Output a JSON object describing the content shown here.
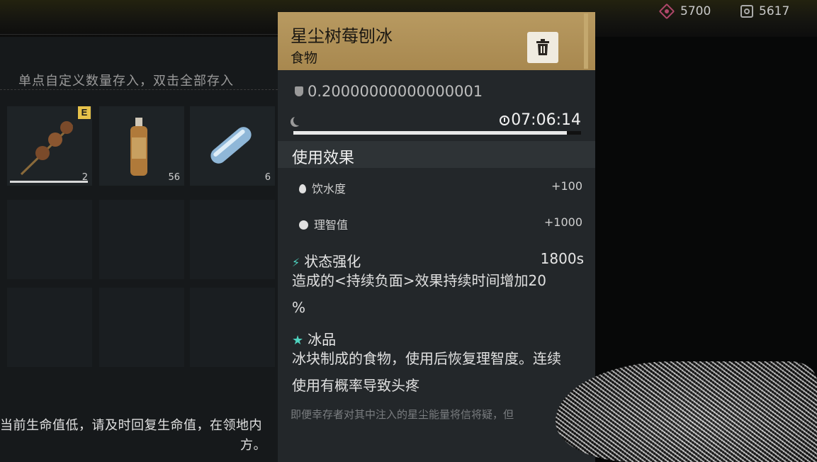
{
  "currencies": [
    {
      "icon": "hex-crystal-icon",
      "amount": "5700",
      "color": "#b0476b"
    },
    {
      "icon": "square-token-icon",
      "amount": "5617",
      "color": "#aaaaaa"
    }
  ],
  "storage": {
    "hint": "单点自定义数量存入，双击全部存入",
    "items": [
      {
        "name": "skewer",
        "badge": "E",
        "qty": "2",
        "selected": true
      },
      {
        "name": "bottle",
        "qty": "56"
      },
      {
        "name": "capsule",
        "qty": "6"
      }
    ],
    "warning_line1": "当前生命值低，请及时回复生命值，在领地内",
    "warning_line2": "方。"
  },
  "item": {
    "title": "星尘树莓刨冰",
    "category": "食物",
    "weight": "0.20000000000000001",
    "timer": "07:06:14",
    "freshness_fraction": 0.95,
    "section_title": "使用效果",
    "effects": [
      {
        "icon": "water-drop-icon",
        "label": "饮水度",
        "value": "+100"
      },
      {
        "icon": "brain-icon",
        "label": "理智值",
        "value": "+1000"
      }
    ],
    "buff": {
      "label": "状态强化",
      "duration": "1800s",
      "desc_line1": "造成的<持续负面>效果持续时间增加20",
      "desc_line2": "%"
    },
    "trait": {
      "label": "冰品",
      "desc_line1": "冰块制成的食物，使用后恢复理智度。连续",
      "desc_line2": "使用有概率导致头疼"
    },
    "lore": "即便幸存者对其中注入的星尘能量将信将疑，但"
  },
  "colors": {
    "header_gold": "#b89a61",
    "accent_cyan": "#4fd4c0"
  }
}
